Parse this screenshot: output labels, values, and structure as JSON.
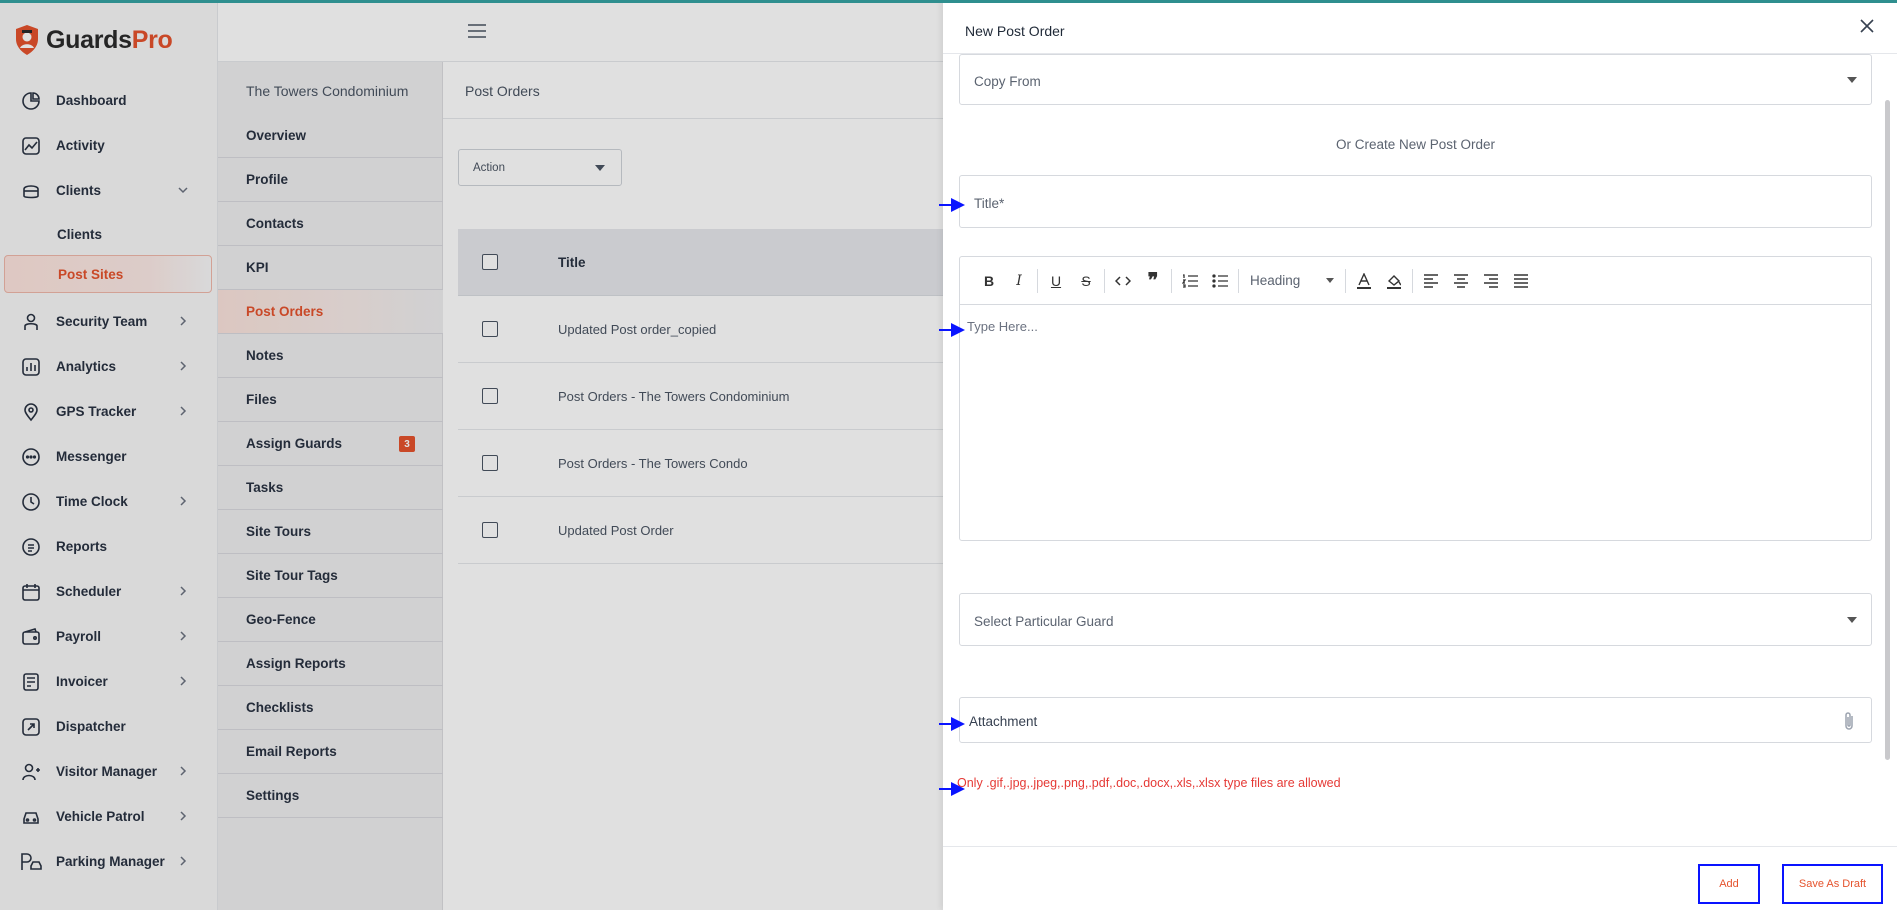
{
  "brand": {
    "name_main": "Guards",
    "name_accent": "Pro"
  },
  "sidebar": {
    "items": [
      {
        "label": "Dashboard",
        "icon": "dashboard-icon"
      },
      {
        "label": "Activity",
        "icon": "activity-icon"
      },
      {
        "label": "Clients",
        "icon": "clients-icon",
        "expanded": true
      },
      {
        "label": "Security Team",
        "icon": "security-team-icon",
        "has_children": true
      },
      {
        "label": "Analytics",
        "icon": "analytics-icon",
        "has_children": true
      },
      {
        "label": "GPS Tracker",
        "icon": "gps-icon",
        "has_children": true
      },
      {
        "label": "Messenger",
        "icon": "messenger-icon"
      },
      {
        "label": "Time Clock",
        "icon": "clock-icon",
        "has_children": true
      },
      {
        "label": "Reports",
        "icon": "reports-icon"
      },
      {
        "label": "Scheduler",
        "icon": "calendar-icon",
        "has_children": true
      },
      {
        "label": "Payroll",
        "icon": "payroll-icon",
        "has_children": true
      },
      {
        "label": "Invoicer",
        "icon": "invoice-icon",
        "has_children": true
      },
      {
        "label": "Dispatcher",
        "icon": "dispatcher-icon"
      },
      {
        "label": "Visitor Manager",
        "icon": "visitor-icon",
        "has_children": true
      },
      {
        "label": "Vehicle Patrol",
        "icon": "car-icon",
        "has_children": true
      },
      {
        "label": "Parking Manager",
        "icon": "parking-icon",
        "has_children": true
      }
    ],
    "clients_sub": [
      "Clients",
      "Post Sites"
    ],
    "active_sub": "Post Sites"
  },
  "site_panel": {
    "title": "The Towers Condominium",
    "items": [
      "Overview",
      "Profile",
      "Contacts",
      "KPI",
      "Post Orders",
      "Notes",
      "Files",
      "Assign Guards",
      "Tasks",
      "Site Tours",
      "Site Tour Tags",
      "Geo-Fence",
      "Assign Reports",
      "Checklists",
      "Email Reports",
      "Settings"
    ],
    "active": "Post Orders",
    "assign_guards_badge": "3"
  },
  "main": {
    "header": "Post Orders",
    "action_label": "Action",
    "table": {
      "column_title": "Title",
      "rows": [
        "Updated Post order_copied",
        "Post Orders - The Towers Condominium",
        "Post Orders - The Towers Condo",
        "Updated Post Order"
      ]
    }
  },
  "drawer": {
    "title": "New Post Order",
    "copy_from_placeholder": "Copy From",
    "or_text": "Or Create New Post Order",
    "title_placeholder": "Title*",
    "heading_select": "Heading",
    "editor_placeholder": "Type Here...",
    "guard_placeholder": "Select Particular Guard",
    "attachment_label": "Attachment",
    "file_note": "Only .gif,.jpg,.jpeg,.png,.pdf,.doc,.docx,.xls,.xlsx type files are allowed",
    "add_button": "Add",
    "draft_button": "Save As Draft"
  },
  "colors": {
    "accent": "#e5532d",
    "annotation_blue": "#0a14ff",
    "error": "#e53935"
  }
}
